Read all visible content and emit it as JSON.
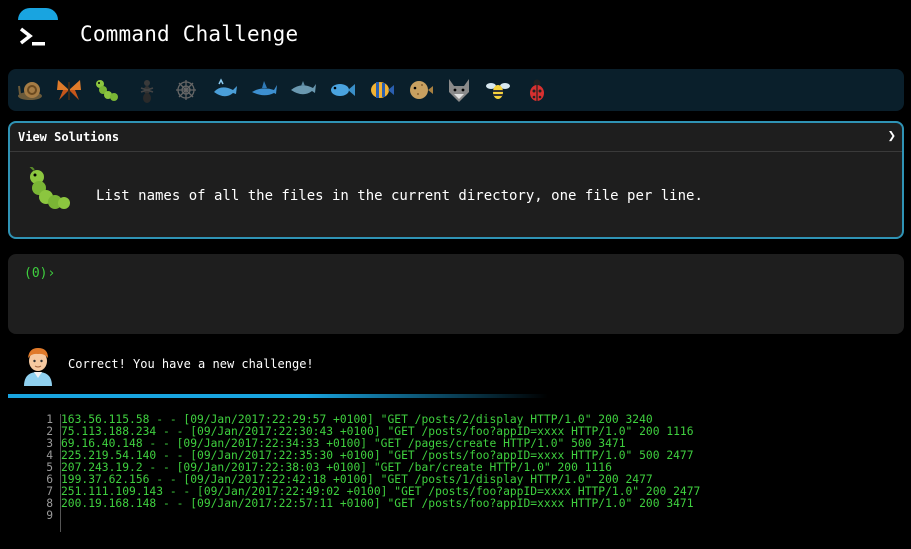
{
  "header": {
    "title": "Command Challenge"
  },
  "creatures": [
    {
      "icon": "snail-icon",
      "color": "#8a6a3a"
    },
    {
      "icon": "butterfly-icon",
      "color": "#e07b2a"
    },
    {
      "icon": "caterpillar-icon",
      "color": "#8cc63f"
    },
    {
      "icon": "ant-icon",
      "color": "#444444"
    },
    {
      "icon": "spider-web-icon",
      "color": "#555555"
    },
    {
      "icon": "whale-icon",
      "color": "#4a9ed8"
    },
    {
      "icon": "shark-icon",
      "color": "#3d8fd0"
    },
    {
      "icon": "dolphin-icon",
      "color": "#6a98b0"
    },
    {
      "icon": "fish-icon",
      "color": "#4aa3df"
    },
    {
      "icon": "tropical-fish-icon",
      "color": "#f2b233"
    },
    {
      "icon": "blowfish-icon",
      "color": "#c8a060"
    },
    {
      "icon": "wolf-icon",
      "color": "#8a8a8a"
    },
    {
      "icon": "bee-icon",
      "color": "#f6d33c"
    },
    {
      "icon": "ladybug-icon",
      "color": "#d83030"
    }
  ],
  "challenge": {
    "view_solutions": "View Solutions",
    "chevron": "❯",
    "text": "List names of all the files in the current directory, one file per line."
  },
  "terminal": {
    "prompt": "(0)›"
  },
  "status": {
    "message": "Correct! You have a new challenge!"
  },
  "log": {
    "lines": [
      {
        "n": "1",
        "text": "163.56.115.58 - - [09/Jan/2017:22:29:57 +0100] \"GET /posts/2/display HTTP/1.0\" 200 3240"
      },
      {
        "n": "2",
        "text": "75.113.188.234 - - [09/Jan/2017:22:30:43 +0100] \"GET /posts/foo?appID=xxxx HTTP/1.0\" 200 1116"
      },
      {
        "n": "3",
        "text": "69.16.40.148 - - [09/Jan/2017:22:34:33 +0100] \"GET /pages/create HTTP/1.0\" 500 3471"
      },
      {
        "n": "4",
        "text": "225.219.54.140 - - [09/Jan/2017:22:35:30 +0100] \"GET /posts/foo?appID=xxxx HTTP/1.0\" 500 2477"
      },
      {
        "n": "5",
        "text": "207.243.19.2 - - [09/Jan/2017:22:38:03 +0100] \"GET /bar/create HTTP/1.0\" 200 1116"
      },
      {
        "n": "6",
        "text": "199.37.62.156 - - [09/Jan/2017:22:42:18 +0100] \"GET /posts/1/display HTTP/1.0\" 200 2477"
      },
      {
        "n": "7",
        "text": "251.111.109.143 - - [09/Jan/2017:22:49:02 +0100] \"GET /posts/foo?appID=xxxx HTTP/1.0\" 200 2477"
      },
      {
        "n": "8",
        "text": "200.19.168.148 - - [09/Jan/2017:22:57:11 +0100] \"GET /posts/foo?appID=xxxx HTTP/1.0\" 200 3471"
      },
      {
        "n": "9",
        "text": ""
      }
    ]
  }
}
